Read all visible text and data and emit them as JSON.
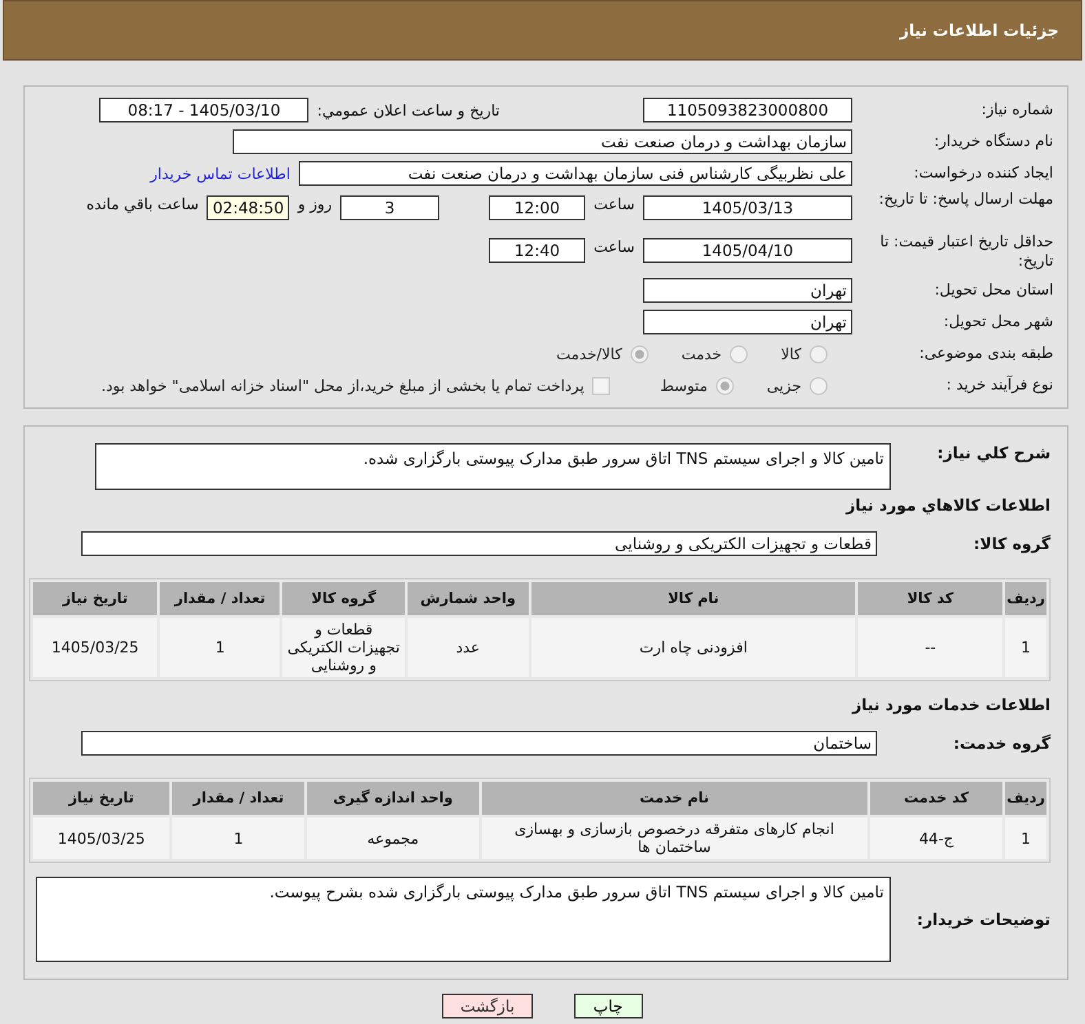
{
  "header": {
    "title": "جزئیات اطلاعات نیاز"
  },
  "need_number": {
    "label": "شماره نیاز:",
    "value": "1105093823000800"
  },
  "announce": {
    "label": "تاريخ و ساعت اعلان عمومي:",
    "value": "1405/03/10 - 08:17"
  },
  "buyer_org": {
    "label": "نام دستگاه خریدار:",
    "value": "سازمان بهداشت و درمان صنعت نفت"
  },
  "creator": {
    "label": "ایجاد کننده درخواست:",
    "value": "علی نظربیگی کارشناس فنی سازمان بهداشت و درمان صنعت نفت",
    "link": "اطلاعات تماس خریدار"
  },
  "deadline": {
    "label": "مهلت ارسال پاسخ: تا تاریخ:",
    "date": "1405/03/13",
    "time_label": "ساعت",
    "time": "12:00",
    "days": "3",
    "days_label": "روز و",
    "remaining": "02:48:50",
    "remaining_label": "ساعت باقي مانده"
  },
  "validity": {
    "label": "حداقل تاریخ اعتبار قیمت: تا تاریخ:",
    "date": "1405/04/10",
    "time_label": "ساعت",
    "time": "12:40"
  },
  "province": {
    "label": "استان محل تحویل:",
    "value": "تهران"
  },
  "city": {
    "label": "شهر محل تحویل:",
    "value": "تهران"
  },
  "category": {
    "label": "طبقه بندی موضوعی:",
    "options": [
      {
        "label": "کالا",
        "selected": false
      },
      {
        "label": "خدمت",
        "selected": false
      },
      {
        "label": "کالا/خدمت",
        "selected": true
      }
    ]
  },
  "process": {
    "label": "نوع فرآیند خرید :",
    "options": [
      {
        "label": "جزیی",
        "selected": false
      },
      {
        "label": "متوسط",
        "selected": true
      }
    ],
    "payment": {
      "label": "پرداخت تمام یا بخشی از مبلغ خرید،از محل \"اسناد خزانه اسلامی\" خواهد بود.",
      "checked": false
    }
  },
  "summary": {
    "label": "شرح كلي نياز:",
    "value": "تامین کالا و اجرای سیستم TNS اتاق سرور طبق مدارک پیوستی بارگزاری شده."
  },
  "goods": {
    "heading": "اطلاعات كالاهاي مورد نياز",
    "group_label": "گروه کالا:",
    "group": "قطعات و تجهیزات الکتریکی و روشنایی",
    "columns": [
      "ردیف",
      "کد کالا",
      "نام کالا",
      "واحد شمارش",
      "گروه کالا",
      "تعداد / مقدار",
      "تاریخ نیاز"
    ],
    "rows": [
      [
        "1",
        "--",
        "افزودنی چاه ارت",
        "عدد",
        "قطعات و تجهیزات الکتریکی و روشنایی",
        "1",
        "1405/03/25"
      ]
    ]
  },
  "services": {
    "heading": "اطلاعات خدمات مورد نیاز",
    "group_label": "گروه خدمت:",
    "group": "ساختمان",
    "columns": [
      "ردیف",
      "کد خدمت",
      "نام خدمت",
      "واحد اندازه گیری",
      "تعداد / مقدار",
      "تاریخ نیاز"
    ],
    "rows": [
      [
        "1",
        "ج-44",
        "انجام کارهای متفرقه درخصوص بازسازی و بهسازی ساختمان ها",
        "مجموعه",
        "1",
        "1405/03/25"
      ]
    ]
  },
  "buyer_notes": {
    "label": "توضیحات خریدار:",
    "value": "تامین کالا و اجرای سیستم TNS اتاق سرور طبق مدارک پیوستی بارگزاری شده بشرح پیوست."
  },
  "buttons": [
    {
      "label": "چاپ",
      "kind": "print"
    },
    {
      "label": "بازگشت",
      "kind": "back"
    }
  ]
}
